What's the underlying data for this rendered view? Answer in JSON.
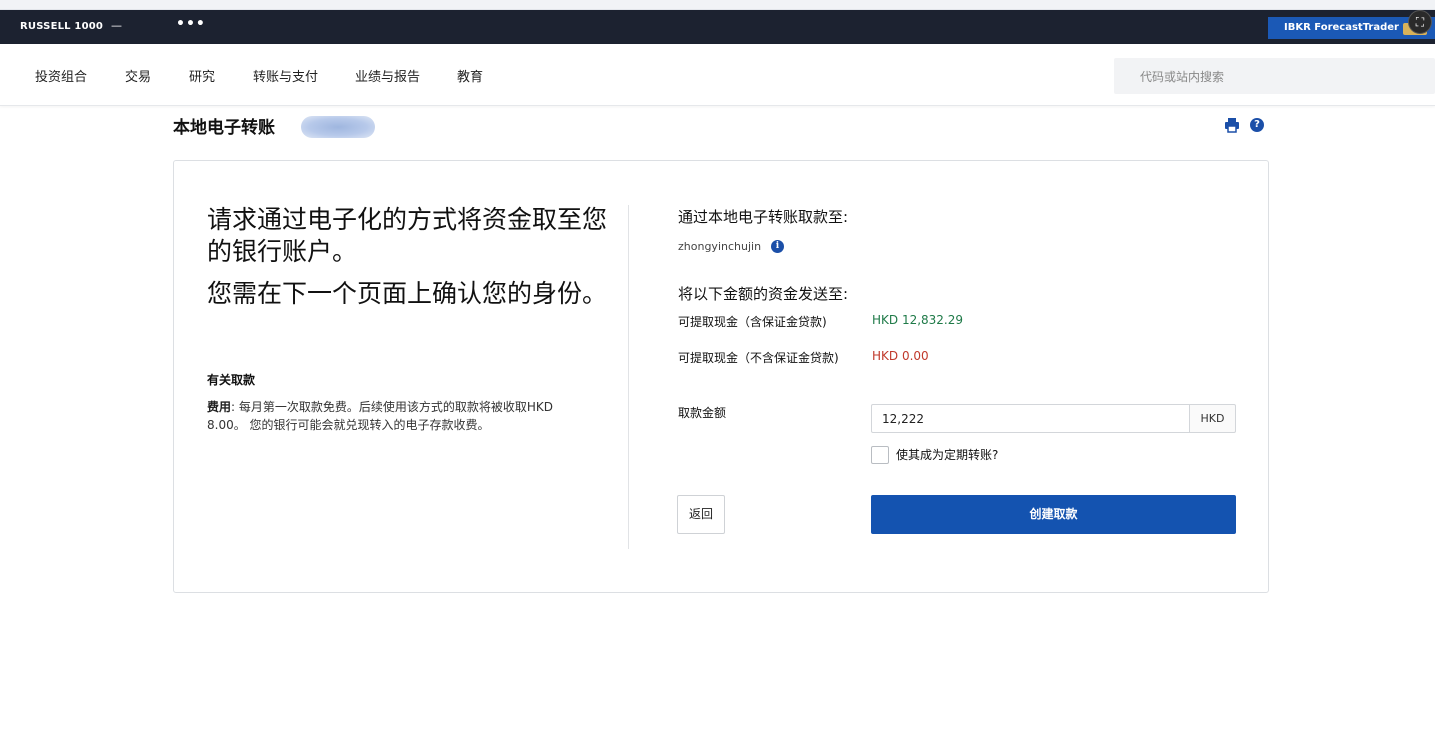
{
  "ticker": {
    "index_name": "RUSSELL 1000",
    "index_value": "—",
    "more_label": "•••",
    "forecast_label": "IBKR ForecastTrader"
  },
  "nav": {
    "items": [
      "投资组合",
      "交易",
      "研究",
      "转账与支付",
      "业绩与报告",
      "教育"
    ],
    "search_placeholder": "代码或站内搜索"
  },
  "page": {
    "title": "本地电子转账",
    "help_glyph": "?"
  },
  "left": {
    "heading_1": "请求通过电子化的方式将资金取至您的银行账户。",
    "heading_2": "您需在下一个页面上确认您的身份。",
    "about_title": "有关取款",
    "fee_label": "费用",
    "fee_text": ": 每月第一次取款免费。后续使用该方式的取款将被收取HKD 8.00。 您的银行可能会就兑现转入的电子存款收费。"
  },
  "right": {
    "withdraw_to_label": "通过本地电子转账取款至:",
    "account_name": "zhongyinchujin",
    "info_glyph": "i",
    "send_amount_label": "将以下金额的资金发送至:",
    "avail_with_margin_label": "可提取现金（含保证金贷款)",
    "avail_with_margin_value": "HKD 12,832.29",
    "avail_without_margin_label": "可提取现金（不含保证金贷款)",
    "avail_without_margin_value": "HKD 0.00",
    "amount_label": "取款金额",
    "amount_value": "12,222",
    "currency": "HKD",
    "recurring_label": "使其成为定期转账?",
    "recurring_checked": false,
    "back_label": "返回",
    "create_label": "创建取款"
  },
  "colors": {
    "topbar": "#1c2230",
    "brand_blue": "#1453b0",
    "positive": "#1f7a48",
    "negative": "#c0392b"
  }
}
